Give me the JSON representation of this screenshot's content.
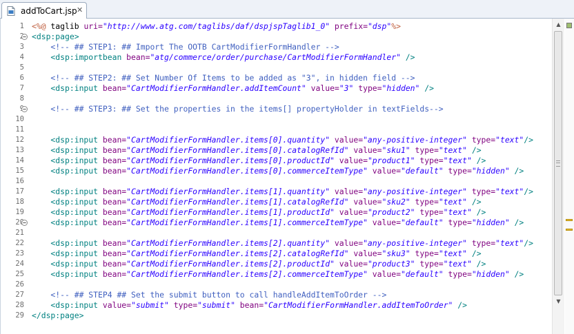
{
  "tab": {
    "label": "addToCart.jsp",
    "close": "✕"
  },
  "editor": {
    "lines": [
      {
        "n": "1",
        "fold": false,
        "tokens": [
          {
            "c": "dir",
            "t": "<%@"
          },
          {
            "c": "plain",
            "t": " taglib "
          },
          {
            "c": "attr",
            "t": "uri="
          },
          {
            "c": "str",
            "t": "\"http://www.atg.com/taglibs/daf/dspjspTaglib1_0\""
          },
          {
            "c": "plain",
            "t": " "
          },
          {
            "c": "attr",
            "t": "prefix="
          },
          {
            "c": "str",
            "t": "\"dsp\""
          },
          {
            "c": "dir",
            "t": "%>"
          }
        ]
      },
      {
        "n": "2",
        "fold": true,
        "tokens": [
          {
            "c": "tag",
            "t": "<dsp:page>"
          }
        ]
      },
      {
        "n": "3",
        "fold": false,
        "tokens": [
          {
            "c": "cmt",
            "t": "    <!-- ## STEP1: ## Import The OOTB CartModifierFormHandler -->"
          }
        ]
      },
      {
        "n": "4",
        "fold": false,
        "tokens": [
          {
            "c": "tag",
            "t": "    <dsp:importbean "
          },
          {
            "c": "attr",
            "t": "bean="
          },
          {
            "c": "str",
            "t": "\"atg/commerce/order/purchase/CartModifierFormHandler\""
          },
          {
            "c": "tag",
            "t": " />"
          }
        ]
      },
      {
        "n": "5",
        "fold": false,
        "tokens": []
      },
      {
        "n": "6",
        "fold": false,
        "tokens": [
          {
            "c": "cmt",
            "t": "    <!-- ## STEP2: ## Set Number Of Items to be added as \"3\", in hidden field -->"
          }
        ]
      },
      {
        "n": "7",
        "fold": false,
        "tokens": [
          {
            "c": "tag",
            "t": "    <dsp:input "
          },
          {
            "c": "attr",
            "t": "bean="
          },
          {
            "c": "str",
            "t": "\"CartModifierFormHandler.addItemCount\""
          },
          {
            "c": "plain",
            "t": " "
          },
          {
            "c": "attr",
            "t": "value="
          },
          {
            "c": "str",
            "t": "\"3\""
          },
          {
            "c": "plain",
            "t": " "
          },
          {
            "c": "attr",
            "t": "type="
          },
          {
            "c": "str",
            "t": "\"hidden\""
          },
          {
            "c": "tag",
            "t": " />"
          }
        ]
      },
      {
        "n": "8",
        "fold": false,
        "tokens": []
      },
      {
        "n": "9",
        "fold": true,
        "tokens": [
          {
            "c": "cmt",
            "t": "    <!-- ## STEP3: ## Set the properties in the items[] propertyHolder in textFields-->"
          }
        ]
      },
      {
        "n": "10",
        "fold": false,
        "tokens": []
      },
      {
        "n": "11",
        "fold": false,
        "tokens": []
      },
      {
        "n": "12",
        "fold": false,
        "tokens": [
          {
            "c": "tag",
            "t": "    <dsp:input "
          },
          {
            "c": "attr",
            "t": "bean="
          },
          {
            "c": "str",
            "t": "\"CartModifierFormHandler.items[0].quantity\""
          },
          {
            "c": "plain",
            "t": " "
          },
          {
            "c": "attr",
            "t": "value="
          },
          {
            "c": "str",
            "t": "\"any-positive-integer\""
          },
          {
            "c": "plain",
            "t": " "
          },
          {
            "c": "attr",
            "t": "type="
          },
          {
            "c": "str",
            "t": "\"text\""
          },
          {
            "c": "tag",
            "t": "/>"
          }
        ]
      },
      {
        "n": "13",
        "fold": false,
        "tokens": [
          {
            "c": "tag",
            "t": "    <dsp:input "
          },
          {
            "c": "attr",
            "t": "bean="
          },
          {
            "c": "str",
            "t": "\"CartModifierFormHandler.items[0].catalogRefId\""
          },
          {
            "c": "plain",
            "t": " "
          },
          {
            "c": "attr",
            "t": "value="
          },
          {
            "c": "str",
            "t": "\"sku1\""
          },
          {
            "c": "plain",
            "t": " "
          },
          {
            "c": "attr",
            "t": "type="
          },
          {
            "c": "str",
            "t": "\"text\""
          },
          {
            "c": "tag",
            "t": " />"
          }
        ]
      },
      {
        "n": "14",
        "fold": false,
        "tokens": [
          {
            "c": "tag",
            "t": "    <dsp:input "
          },
          {
            "c": "attr",
            "t": "bean="
          },
          {
            "c": "str",
            "t": "\"CartModifierFormHandler.items[0].productId\""
          },
          {
            "c": "plain",
            "t": " "
          },
          {
            "c": "attr",
            "t": "value="
          },
          {
            "c": "str",
            "t": "\"product1\""
          },
          {
            "c": "plain",
            "t": " "
          },
          {
            "c": "attr",
            "t": "type="
          },
          {
            "c": "str",
            "t": "\"text\""
          },
          {
            "c": "tag",
            "t": " />"
          }
        ]
      },
      {
        "n": "15",
        "fold": false,
        "tokens": [
          {
            "c": "tag",
            "t": "    <dsp:input "
          },
          {
            "c": "attr",
            "t": "bean="
          },
          {
            "c": "str",
            "t": "\"CartModifierFormHandler.items[0].commerceItemType\""
          },
          {
            "c": "plain",
            "t": " "
          },
          {
            "c": "attr",
            "t": "value="
          },
          {
            "c": "str",
            "t": "\"default\""
          },
          {
            "c": "plain",
            "t": " "
          },
          {
            "c": "attr",
            "t": "type="
          },
          {
            "c": "str",
            "t": "\"hidden\""
          },
          {
            "c": "tag",
            "t": " />"
          }
        ]
      },
      {
        "n": "16",
        "fold": false,
        "tokens": []
      },
      {
        "n": "17",
        "fold": false,
        "tokens": [
          {
            "c": "tag",
            "t": "    <dsp:input "
          },
          {
            "c": "attr",
            "t": "bean="
          },
          {
            "c": "str",
            "t": "\"CartModifierFormHandler.items[1].quantity\""
          },
          {
            "c": "plain",
            "t": " "
          },
          {
            "c": "attr",
            "t": "value="
          },
          {
            "c": "str",
            "t": "\"any-positive-integer\""
          },
          {
            "c": "plain",
            "t": " "
          },
          {
            "c": "attr",
            "t": "type="
          },
          {
            "c": "str",
            "t": "\"text\""
          },
          {
            "c": "tag",
            "t": "/>"
          }
        ]
      },
      {
        "n": "18",
        "fold": false,
        "tokens": [
          {
            "c": "tag",
            "t": "    <dsp:input "
          },
          {
            "c": "attr",
            "t": "bean="
          },
          {
            "c": "str",
            "t": "\"CartModifierFormHandler.items[1].catalogRefId\""
          },
          {
            "c": "plain",
            "t": " "
          },
          {
            "c": "attr",
            "t": "value="
          },
          {
            "c": "str",
            "t": "\"sku2\""
          },
          {
            "c": "plain",
            "t": " "
          },
          {
            "c": "attr",
            "t": "type="
          },
          {
            "c": "str",
            "t": "\"text\""
          },
          {
            "c": "tag",
            "t": " />"
          }
        ]
      },
      {
        "n": "19",
        "fold": false,
        "tokens": [
          {
            "c": "tag",
            "t": "    <dsp:input "
          },
          {
            "c": "attr",
            "t": "bean="
          },
          {
            "c": "str",
            "t": "\"CartModifierFormHandler.items[1].productId\""
          },
          {
            "c": "plain",
            "t": " "
          },
          {
            "c": "attr",
            "t": "value="
          },
          {
            "c": "str",
            "t": "\"product2\""
          },
          {
            "c": "plain",
            "t": " "
          },
          {
            "c": "attr",
            "t": "type="
          },
          {
            "c": "str",
            "t": "\"text\""
          },
          {
            "c": "tag",
            "t": " />"
          }
        ]
      },
      {
        "n": "20",
        "fold": true,
        "tokens": [
          {
            "c": "tag",
            "t": "    <dsp:input "
          },
          {
            "c": "attr",
            "t": "bean="
          },
          {
            "c": "str",
            "t": "\"CartModifierFormHandler.items[1].commerceItemType\""
          },
          {
            "c": "plain",
            "t": " "
          },
          {
            "c": "attr",
            "t": "value="
          },
          {
            "c": "str",
            "t": "\"default\""
          },
          {
            "c": "plain",
            "t": " "
          },
          {
            "c": "attr",
            "t": "type="
          },
          {
            "c": "str",
            "t": "\"hidden\""
          },
          {
            "c": "tag",
            "t": " />"
          }
        ]
      },
      {
        "n": "21",
        "fold": false,
        "tokens": []
      },
      {
        "n": "22",
        "fold": false,
        "tokens": [
          {
            "c": "tag",
            "t": "    <dsp:input "
          },
          {
            "c": "attr",
            "t": "bean="
          },
          {
            "c": "str",
            "t": "\"CartModifierFormHandler.items[2].quantity\""
          },
          {
            "c": "plain",
            "t": " "
          },
          {
            "c": "attr",
            "t": "value="
          },
          {
            "c": "str",
            "t": "\"any-positive-integer\""
          },
          {
            "c": "plain",
            "t": " "
          },
          {
            "c": "attr",
            "t": "type="
          },
          {
            "c": "str",
            "t": "\"text\""
          },
          {
            "c": "tag",
            "t": "/>"
          }
        ]
      },
      {
        "n": "23",
        "fold": false,
        "tokens": [
          {
            "c": "tag",
            "t": "    <dsp:input "
          },
          {
            "c": "attr",
            "t": "bean="
          },
          {
            "c": "str",
            "t": "\"CartModifierFormHandler.items[2].catalogRefId\""
          },
          {
            "c": "plain",
            "t": " "
          },
          {
            "c": "attr",
            "t": "value="
          },
          {
            "c": "str",
            "t": "\"sku3\""
          },
          {
            "c": "plain",
            "t": " "
          },
          {
            "c": "attr",
            "t": "type="
          },
          {
            "c": "str",
            "t": "\"text\""
          },
          {
            "c": "tag",
            "t": " />"
          }
        ]
      },
      {
        "n": "24",
        "fold": false,
        "tokens": [
          {
            "c": "tag",
            "t": "    <dsp:input "
          },
          {
            "c": "attr",
            "t": "bean="
          },
          {
            "c": "str",
            "t": "\"CartModifierFormHandler.items[2].productId\""
          },
          {
            "c": "plain",
            "t": " "
          },
          {
            "c": "attr",
            "t": "value="
          },
          {
            "c": "str",
            "t": "\"product3\""
          },
          {
            "c": "plain",
            "t": " "
          },
          {
            "c": "attr",
            "t": "type="
          },
          {
            "c": "str",
            "t": "\"text\""
          },
          {
            "c": "tag",
            "t": " />"
          }
        ]
      },
      {
        "n": "25",
        "fold": false,
        "tokens": [
          {
            "c": "tag",
            "t": "    <dsp:input "
          },
          {
            "c": "attr",
            "t": "bean="
          },
          {
            "c": "str",
            "t": "\"CartModifierFormHandler.items[2].commerceItemType\""
          },
          {
            "c": "plain",
            "t": " "
          },
          {
            "c": "attr",
            "t": "value="
          },
          {
            "c": "str",
            "t": "\"default\""
          },
          {
            "c": "plain",
            "t": " "
          },
          {
            "c": "attr",
            "t": "type="
          },
          {
            "c": "str",
            "t": "\"hidden\""
          },
          {
            "c": "tag",
            "t": " />"
          }
        ]
      },
      {
        "n": "26",
        "fold": false,
        "tokens": []
      },
      {
        "n": "27",
        "fold": false,
        "tokens": [
          {
            "c": "cmt",
            "t": "    <!-- ## STEP4 ## Set the submit button to call handleAddItemToOrder -->"
          }
        ]
      },
      {
        "n": "28",
        "fold": false,
        "tokens": [
          {
            "c": "tag",
            "t": "    <dsp:input "
          },
          {
            "c": "attr",
            "t": "value="
          },
          {
            "c": "str",
            "t": "\"submit\""
          },
          {
            "c": "plain",
            "t": " "
          },
          {
            "c": "attr",
            "t": "type="
          },
          {
            "c": "str",
            "t": "\"submit\""
          },
          {
            "c": "plain",
            "t": " "
          },
          {
            "c": "attr",
            "t": "bean="
          },
          {
            "c": "str",
            "t": "\"CartModifierFormHandler.addItemToOrder\""
          },
          {
            "c": "tag",
            "t": " />"
          }
        ]
      },
      {
        "n": "29",
        "fold": false,
        "tokens": [
          {
            "c": "tag",
            "t": "</dsp:page>"
          }
        ]
      }
    ]
  },
  "colors": {
    "tag": "#008080",
    "attribute": "#7f007f",
    "string": "#2a00ff",
    "comment": "#3f5fbf",
    "directive": "#bf5f3f",
    "warning_marker": "#e8c034"
  }
}
